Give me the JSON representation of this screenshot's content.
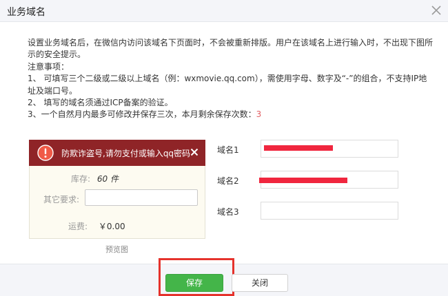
{
  "dialog": {
    "title": "业务域名"
  },
  "intro": {
    "line1": "设置业务域名后，在微信内访问该域名下页面时，不会被重新排版。用户在该域名上进行输入时，不出现下图所示的安全提示。",
    "notes_title": "注意事项：",
    "note1": "1、 可填写三个二级或二级以上域名（例：wxmovie.qq.com），需使用字母、数字及“-”的组合，不支持IP地址及端口号。",
    "note2": "2、 填写的域名须通过ICP备案的验证。",
    "note3_prefix": "3、一个自然月内最多可修改并保存三次，本月剩余保存次数：",
    "note3_count": "3"
  },
  "preview": {
    "warning_text": "防欺诈盗号,请勿支付或输入qq密码",
    "stock_label": "库存:",
    "stock_value": "60 件",
    "other_label": "其它要求:",
    "shipping_label": "运费:",
    "shipping_value": "￥0.00",
    "caption": "预览图"
  },
  "domains": [
    {
      "label": "域名1",
      "value": ""
    },
    {
      "label": "域名2",
      "value": ""
    },
    {
      "label": "域名3",
      "value": ""
    }
  ],
  "footer": {
    "save_label": "保存",
    "close_label": "关闭"
  },
  "colors": {
    "accent_green": "#44b549",
    "warning_bg": "#8f2427",
    "highlight_red": "#e5322c",
    "remaining_count": "#e15f63"
  }
}
